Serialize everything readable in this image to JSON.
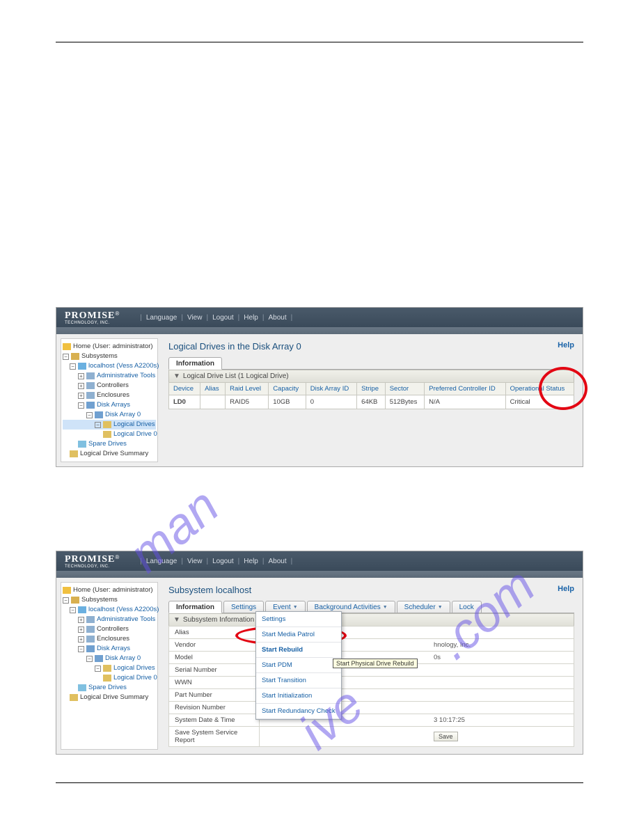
{
  "brand": {
    "name": "PROMISE",
    "sub": "TECHNOLOGY, INC."
  },
  "topmenu": [
    "Language",
    "View",
    "Logout",
    "Help",
    "About"
  ],
  "help": "Help",
  "tree1": {
    "home": "Home (User: administrator)",
    "subsystems": "Subsystems",
    "host": "localhost (Vess A2200s)",
    "admin": "Administrative Tools",
    "controllers": "Controllers",
    "enclosures": "Enclosures",
    "diskarrays": "Disk Arrays",
    "da0": "Disk Array 0",
    "lds": "Logical Drives",
    "ld0": "Logical Drive 0",
    "spare": "Spare Drives",
    "ldsum": "Logical Drive Summary"
  },
  "screen1": {
    "title": "Logical Drives in the Disk Array 0",
    "tab": "Information",
    "section": "Logical Drive List (1 Logical Drive)",
    "columns": [
      "Device",
      "Alias",
      "Raid Level",
      "Capacity",
      "Disk Array ID",
      "Stripe",
      "Sector",
      "Preferred Controller ID",
      "Operational Status"
    ],
    "row": {
      "device": "LD0",
      "alias": "",
      "raid": "RAID5",
      "cap": "10GB",
      "daid": "0",
      "stripe": "64KB",
      "sector": "512Bytes",
      "ctrl": "N/A",
      "status": "Critical"
    }
  },
  "screen2": {
    "title": "Subsystem localhost",
    "tabs": [
      "Information",
      "Settings",
      "Event",
      "Background Activities",
      "Scheduler",
      "Lock"
    ],
    "section": "Subsystem Information",
    "rows": [
      {
        "k": "Alias",
        "v": ""
      },
      {
        "k": "Vendor",
        "v": "hnology, Inc."
      },
      {
        "k": "Model",
        "v": "0s"
      },
      {
        "k": "Serial Number",
        "v": ""
      },
      {
        "k": "WWN",
        "v": ""
      },
      {
        "k": "Part Number",
        "v": ""
      },
      {
        "k": "Revision Number",
        "v": ""
      },
      {
        "k": "System Date & Time",
        "v": "3 10:17:25"
      },
      {
        "k": "Save System Service Report",
        "v": ""
      }
    ],
    "saveBtn": "Save",
    "dropdown": [
      "Settings",
      "Start Media Patrol",
      "Start Rebuild",
      "Start PDM",
      "Start Transition",
      "Start Initialization",
      "Start Redundancy Check"
    ],
    "tooltip": "Start Physical Drive Rebuild"
  }
}
